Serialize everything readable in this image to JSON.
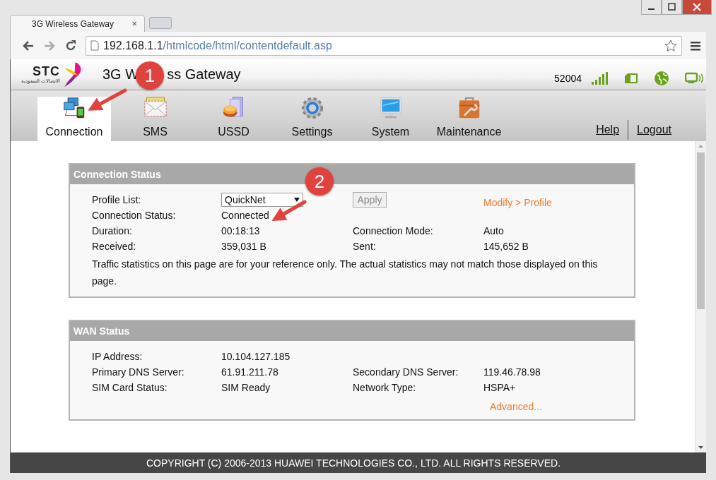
{
  "browser": {
    "tab_title": "3G Wireless Gateway",
    "tab_close": "×",
    "url_host": "192.168.1.1",
    "url_path": "/htmlcode/html/contentdefault.asp"
  },
  "header": {
    "logo_text": "STC",
    "logo_subtext": "الاتصالات السعودية",
    "title_parts": [
      "3G W",
      "ss Gateway"
    ],
    "operator_code": "52004"
  },
  "nav": {
    "tabs": [
      {
        "label": "Connection",
        "selected": true
      },
      {
        "label": "SMS",
        "selected": false
      },
      {
        "label": "USSD",
        "selected": false
      },
      {
        "label": "Settings",
        "selected": false
      },
      {
        "label": "System",
        "selected": false
      },
      {
        "label": "Maintenance",
        "selected": false
      }
    ],
    "links": [
      "Help",
      "Logout"
    ]
  },
  "connection_status": {
    "title": "Connection Status",
    "profile_label": "Profile List:",
    "profile_value": "QuickNet",
    "apply_button": {
      "label": "Apply",
      "disabled": true
    },
    "modify_link": "Modify > Profile",
    "rows": [
      {
        "cells": [
          "Connection Status:",
          "Connected"
        ]
      },
      {
        "cells": [
          "Duration:",
          "00:18:13",
          "Connection Mode:",
          "Auto"
        ]
      },
      {
        "cells": [
          "Received:",
          "359,031 B",
          "Sent:",
          "145,652 B"
        ]
      }
    ],
    "note": "Traffic statistics on this page are for your reference only. The actual statistics may not match those displayed on this page."
  },
  "wan_status": {
    "title": "WAN Status",
    "rows": [
      {
        "cells": [
          "IP Address:",
          "10.104.127.185"
        ]
      },
      {
        "cells": [
          "Primary DNS Server:",
          "61.91.211.78",
          "Secondary DNS Server:",
          "119.46.78.98"
        ]
      },
      {
        "cells": [
          "SIM Card Status:",
          "SIM Ready",
          "Network Type:",
          "HSPA+"
        ]
      }
    ],
    "advanced_link": "Advanced..."
  },
  "footer": "COPYRIGHT (C) 2006-2013 HUAWEI TECHNOLOGIES CO., LTD. ALL RIGHTS RESERVED.",
  "annotations": [
    {
      "label": "1"
    },
    {
      "label": "2"
    }
  ]
}
